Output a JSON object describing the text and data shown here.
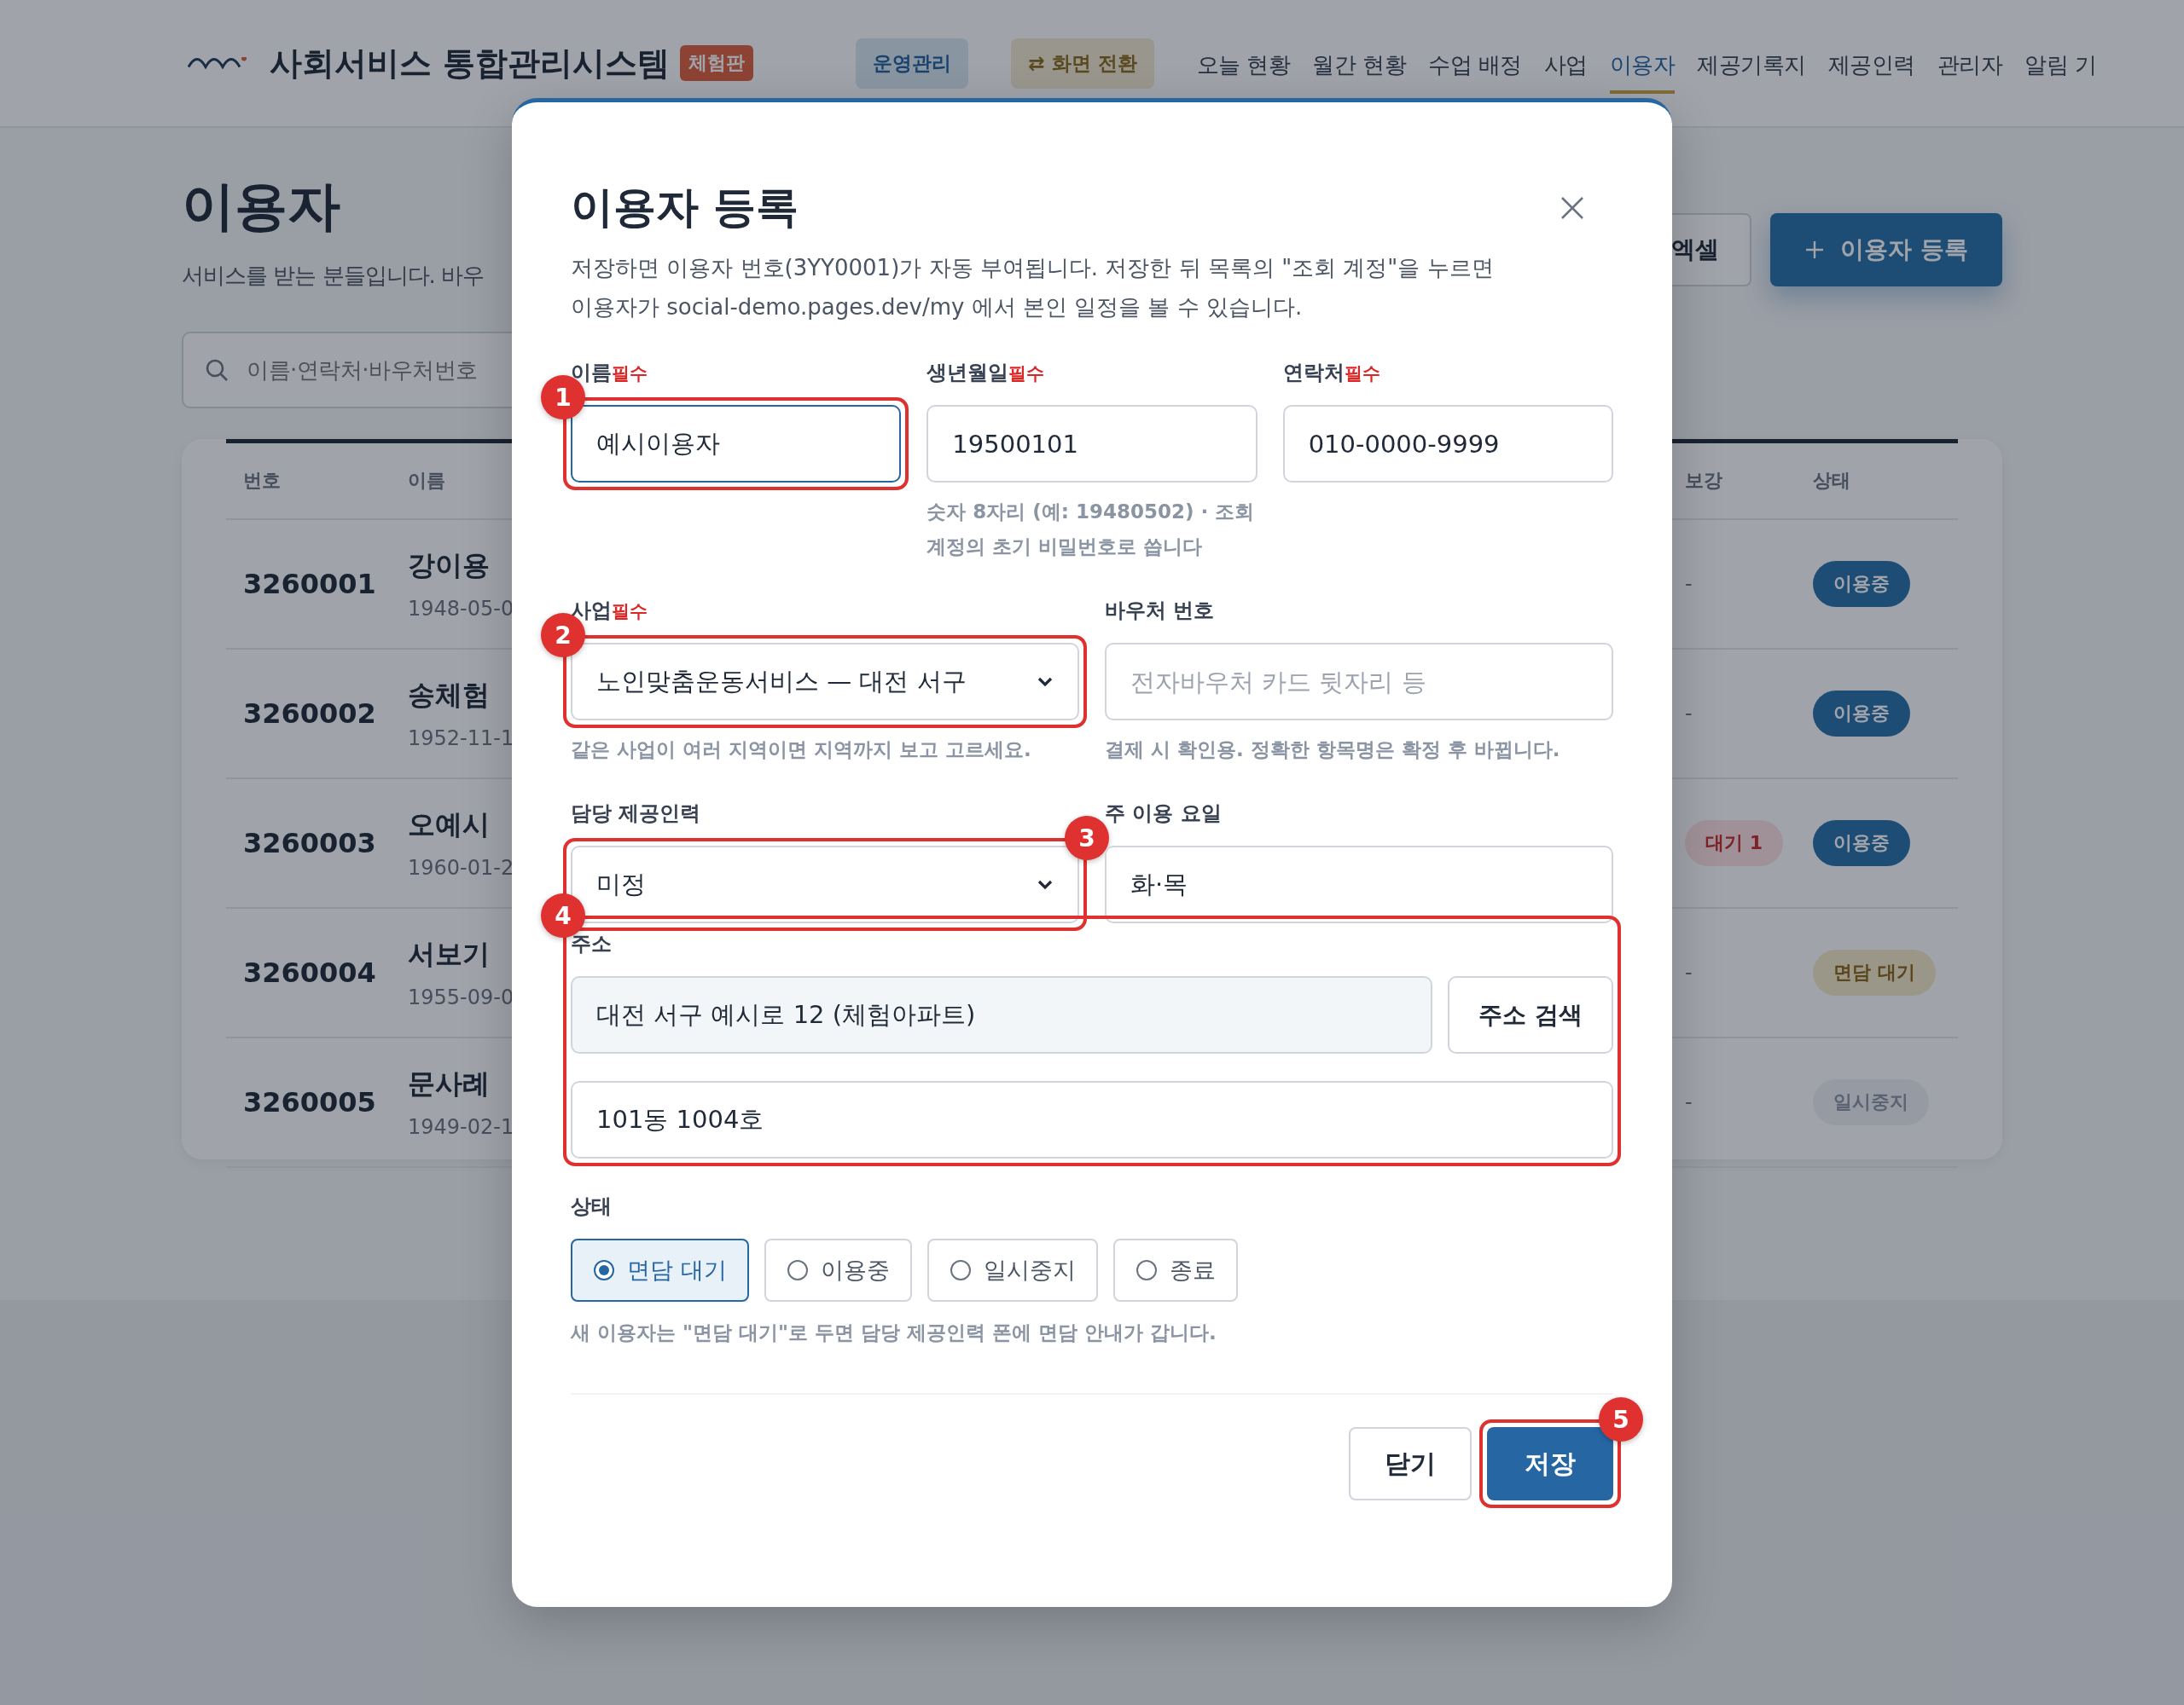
{
  "header": {
    "logo_title": "사회서비스 통합관리시스템",
    "edition": "체험판",
    "mode": "운영관리",
    "switch_button": "⇄ 화면 전환",
    "nav": [
      {
        "label": "오늘 현황",
        "selected": false
      },
      {
        "label": "월간 현황",
        "selected": false
      },
      {
        "label": "수업 배정",
        "selected": false
      },
      {
        "label": "사업",
        "selected": false
      },
      {
        "label": "이용자",
        "selected": true
      },
      {
        "label": "제공기록지",
        "selected": false
      },
      {
        "label": "제공인력",
        "selected": false
      },
      {
        "label": "관리자",
        "selected": false
      },
      {
        "label": "알림 기",
        "selected": false
      }
    ]
  },
  "page": {
    "title": "이용자",
    "subtitle": "서비스를 받는 분들입니다. 바우",
    "export_button": "엑셀",
    "add_button": "이용자 등록",
    "search_placeholder": "이름·연락처·바우처번호"
  },
  "table": {
    "columns": [
      "번호",
      "이름",
      "보강",
      "상태"
    ],
    "rows": [
      {
        "number": "3260001",
        "name": "강이용",
        "birth": "1948-05-0",
        "makeup": {
          "text": "-",
          "kind": "plain"
        },
        "status": {
          "text": "이용중",
          "kind": "active"
        }
      },
      {
        "number": "3260002",
        "name": "송체험",
        "birth": "1952-11-1",
        "makeup": {
          "text": "-",
          "kind": "plain"
        },
        "status": {
          "text": "이용중",
          "kind": "active"
        }
      },
      {
        "number": "3260003",
        "name": "오예시",
        "birth": "1960-01-2",
        "makeup": {
          "text": "대기 1",
          "kind": "badge"
        },
        "status": {
          "text": "이용중",
          "kind": "active"
        }
      },
      {
        "number": "3260004",
        "name": "서보기",
        "birth": "1955-09-0",
        "makeup": {
          "text": "-",
          "kind": "plain"
        },
        "status": {
          "text": "면담 대기",
          "kind": "waiting"
        }
      },
      {
        "number": "3260005",
        "name": "문사례",
        "birth": "1949-02-1",
        "makeup": {
          "text": "-",
          "kind": "plain"
        },
        "status": {
          "text": "일시중지",
          "kind": "paused"
        }
      }
    ]
  },
  "dialog": {
    "title": "이용자 등록",
    "description": "저장하면 이용자 번호(3YY0001)가 자동 부여됩니다. 저장한 뒤 목록의 \"조회 계정\"을 누르면\n이용자가 social-demo.pages.dev/my 에서 본인 일정을 볼 수 있습니다.",
    "rows": [
      {
        "fields": [
          {
            "kind": "input",
            "label": "이름",
            "required": "필수",
            "value": "예시이용자",
            "focused": true,
            "marker": {
              "label": "1",
              "kind": "left"
            }
          },
          {
            "kind": "input",
            "label": "생년월일",
            "required": "필수",
            "value": "19500101",
            "focused": false,
            "help": "숫자 8자리 (예: 19480502) · 조회\n계정의 초기 비밀번호로 씁니다"
          },
          {
            "kind": "input",
            "label": "연락처",
            "required": "필수",
            "value": "010-0000-9999",
            "focused": false
          }
        ]
      },
      {
        "fields": [
          {
            "kind": "select",
            "label": "사업",
            "required": "필수",
            "value": "노인맞춤운동서비스 — 대전 서구",
            "focused": false,
            "help": "같은 사업이 여러 지역이면 지역까지 보고 고르세요.",
            "marker": {
              "label": "2",
              "kind": "left"
            }
          },
          {
            "kind": "input",
            "label": "바우처 번호",
            "placeholder": "전자바우처 카드 뒷자리 등",
            "focused": false,
            "help": "결제 시 확인용. 정확한 항목명은 확정 후 바뀝니다."
          }
        ]
      },
      {
        "fields": [
          {
            "kind": "select",
            "label": "담당 제공인력",
            "value": "미정",
            "focused": false,
            "marker": {
              "label": "3",
              "kind": "right"
            }
          },
          {
            "kind": "input",
            "label": "주 이용 요일",
            "value": "화·목",
            "focused": false
          }
        ]
      }
    ],
    "address": {
      "label": "주소",
      "value": "대전 서구 예시로 12 (체험아파트)",
      "search_button": "주소 검색",
      "detail_value": "101동 1004호",
      "marker": {
        "label": "4",
        "kind": "left"
      }
    },
    "status": {
      "label": "상태",
      "options": [
        {
          "label": "면담 대기",
          "selected": true
        },
        {
          "label": "이용중",
          "selected": false
        },
        {
          "label": "일시중지",
          "selected": false
        },
        {
          "label": "종료",
          "selected": false
        }
      ],
      "help": "새 이용자는 \"면담 대기\"로 두면 담당 제공인력 폰에 면담 안내가 갑니다."
    },
    "buttons": [
      {
        "label": "닫기",
        "kind": "secondary"
      },
      {
        "label": "저장",
        "kind": "primary",
        "marker": {
          "label": "5",
          "kind": "right"
        }
      }
    ]
  }
}
